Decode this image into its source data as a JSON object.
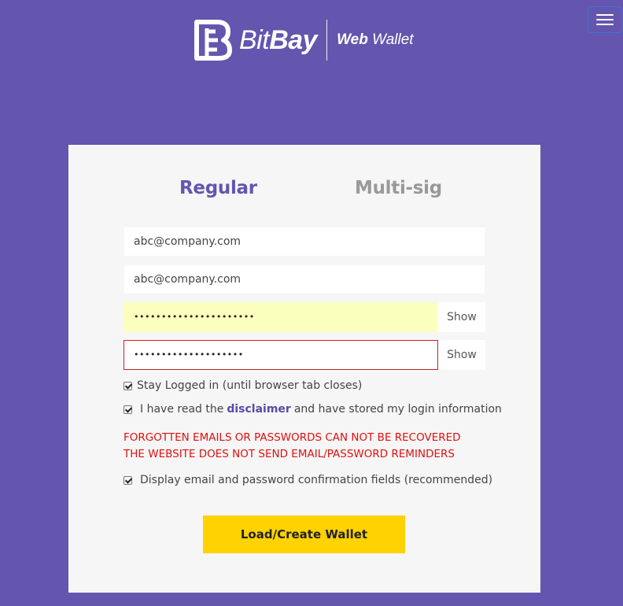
{
  "header": {
    "brand_bit": "Bit",
    "brand_bay": "Bay",
    "product_bold": "Web",
    "product_rest": " Wallet",
    "menu_icon": "hamburger-menu-icon"
  },
  "tabs": [
    {
      "label": "Regular",
      "active": true,
      "color": "#6456ae"
    },
    {
      "label": "Multi-sig",
      "active": false,
      "color": "#999999"
    }
  ],
  "form": {
    "email": "abc@company.com",
    "email_confirm": "abc@company.com",
    "password_masked": "••••••••••••••••••••••",
    "password_confirm_masked": "••••••••••••••••••••",
    "show_label": "Show",
    "stay_logged_in": {
      "checked": true,
      "label": "Stay Logged in (until browser tab closes)"
    },
    "disclaimer_ack": {
      "checked": true,
      "before": "I have read the",
      "link": "disclaimer",
      "after": "and have stored my login information"
    },
    "warning_lines": [
      "FORGOTTEN EMAILS OR PASSWORDS CAN NOT BE RECOVERED",
      "THE WEBSITE DOES NOT SEND EMAIL/PASSWORD REMINDERS"
    ],
    "show_confirm_fields": {
      "checked": true,
      "label": "Display email and password confirmation fields (recommended)"
    },
    "submit_label": "Load/Create Wallet"
  },
  "colors": {
    "background": "#6456ae",
    "accent": "#ffd200",
    "warning": "#e01010",
    "autofill": "#fbffbd",
    "error_border": "#cc2020"
  }
}
